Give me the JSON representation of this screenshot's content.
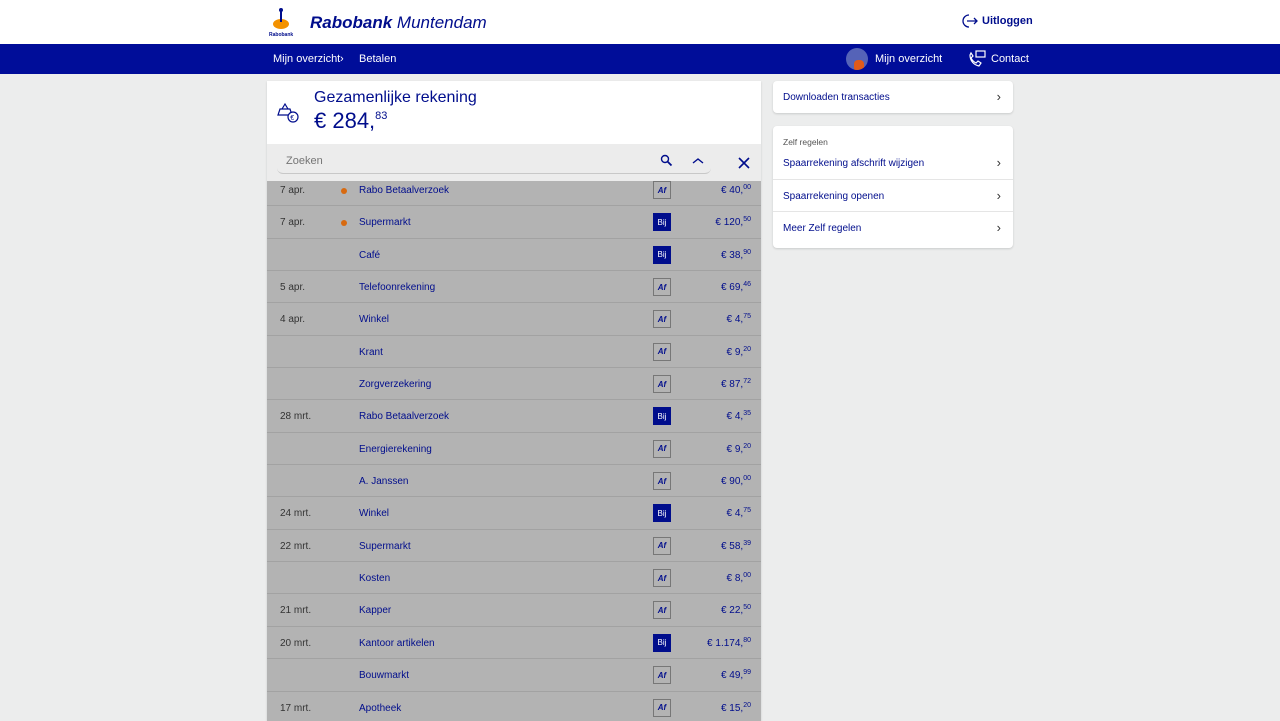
{
  "header": {
    "brand_bold": "Rabobank",
    "brand_light": "Muntendam",
    "logo_text": "Rabobank",
    "logout": "Uitloggen"
  },
  "nav": {
    "crumb1": "Mijn overzicht",
    "crumb2": "Betalen",
    "overview": "Mijn overzicht",
    "contact": "Contact"
  },
  "account": {
    "title": "Gezamenlijke rekening",
    "amount_main": "€ 284,",
    "amount_cents": "83"
  },
  "search": {
    "placeholder": "Zoeken"
  },
  "transactions": [
    {
      "date": "7 apr.",
      "dot": true,
      "desc": "Rabo Betaalverzoek",
      "type": "Af",
      "amt": "€ 40,",
      "cents": "00"
    },
    {
      "date": "7 apr.",
      "dot": true,
      "desc": "Supermarkt",
      "type": "Bij",
      "amt": "€ 120,",
      "cents": "50"
    },
    {
      "date": "",
      "dot": false,
      "desc": "Café",
      "type": "Bij",
      "amt": "€ 38,",
      "cents": "90"
    },
    {
      "date": "5 apr.",
      "dot": false,
      "desc": "Telefoonrekening",
      "type": "Af",
      "amt": "€ 69,",
      "cents": "46"
    },
    {
      "date": "4 apr.",
      "dot": false,
      "desc": "Winkel",
      "type": "Af",
      "amt": "€ 4,",
      "cents": "75"
    },
    {
      "date": "",
      "dot": false,
      "desc": "Krant",
      "type": "Af",
      "amt": "€ 9,",
      "cents": "20"
    },
    {
      "date": "",
      "dot": false,
      "desc": "Zorgverzekering",
      "type": "Af",
      "amt": "€ 87,",
      "cents": "72"
    },
    {
      "date": "28 mrt.",
      "dot": false,
      "desc": "Rabo Betaalverzoek",
      "type": "Bij",
      "amt": "€ 4,",
      "cents": "35"
    },
    {
      "date": "",
      "dot": false,
      "desc": "Energierekening",
      "type": "Af",
      "amt": "€ 9,",
      "cents": "20"
    },
    {
      "date": "",
      "dot": false,
      "desc": "A. Janssen",
      "type": "Af",
      "amt": "€ 90,",
      "cents": "00"
    },
    {
      "date": "24 mrt.",
      "dot": false,
      "desc": "Winkel",
      "type": "Bij",
      "amt": "€ 4,",
      "cents": "75"
    },
    {
      "date": "22 mrt.",
      "dot": false,
      "desc": "Supermarkt",
      "type": "Af",
      "amt": "€ 58,",
      "cents": "39"
    },
    {
      "date": "",
      "dot": false,
      "desc": "Kosten",
      "type": "Af",
      "amt": "€ 8,",
      "cents": "00"
    },
    {
      "date": "21 mrt.",
      "dot": false,
      "desc": "Kapper",
      "type": "Af",
      "amt": "€ 22,",
      "cents": "50"
    },
    {
      "date": "20 mrt.",
      "dot": false,
      "desc": "Kantoor artikelen",
      "type": "Bij",
      "amt": "€ 1.174,",
      "cents": "80"
    },
    {
      "date": "",
      "dot": false,
      "desc": "Bouwmarkt",
      "type": "Af",
      "amt": "€ 49,",
      "cents": "99"
    },
    {
      "date": "17 mrt.",
      "dot": false,
      "desc": "Apotheek",
      "type": "Af",
      "amt": "€ 15,",
      "cents": "20"
    }
  ],
  "side": {
    "download": "Downloaden transacties",
    "zelf_title": "Zelf regelen",
    "items": [
      "Spaarrekening afschrift wijzigen",
      "Spaarrekening openen",
      "Meer Zelf regelen"
    ]
  },
  "colors": {
    "brand": "#000d99",
    "dot": "#d86a10"
  }
}
